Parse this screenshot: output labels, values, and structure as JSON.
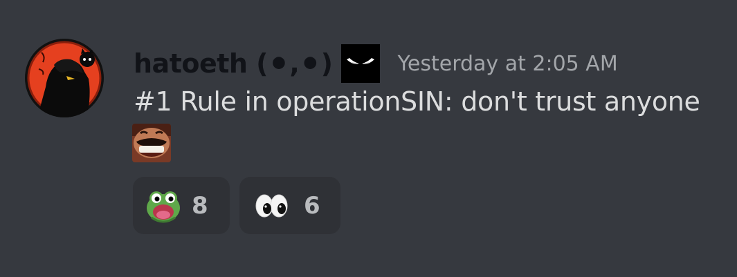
{
  "message": {
    "username": "hatoeth (⚫,⚫)",
    "username_icon": "glowing-eyes-icon",
    "timestamp": "Yesterday at 2:05 AM",
    "content": "#1 Rule in operationSIN: don't trust anyone",
    "inline_emoji": "laughing-man-emoji",
    "avatar": "avatar-dark-figure-red-circle"
  },
  "reactions": [
    {
      "emoji": "pepe-frog-emoji",
      "count": "8"
    },
    {
      "emoji": "eyes-emoji",
      "count": "6"
    }
  ],
  "colors": {
    "background": "#36393f",
    "reaction_bg": "#2f3136",
    "text": "#dcddde",
    "timestamp": "#a3a6aa",
    "username": "#111318"
  }
}
